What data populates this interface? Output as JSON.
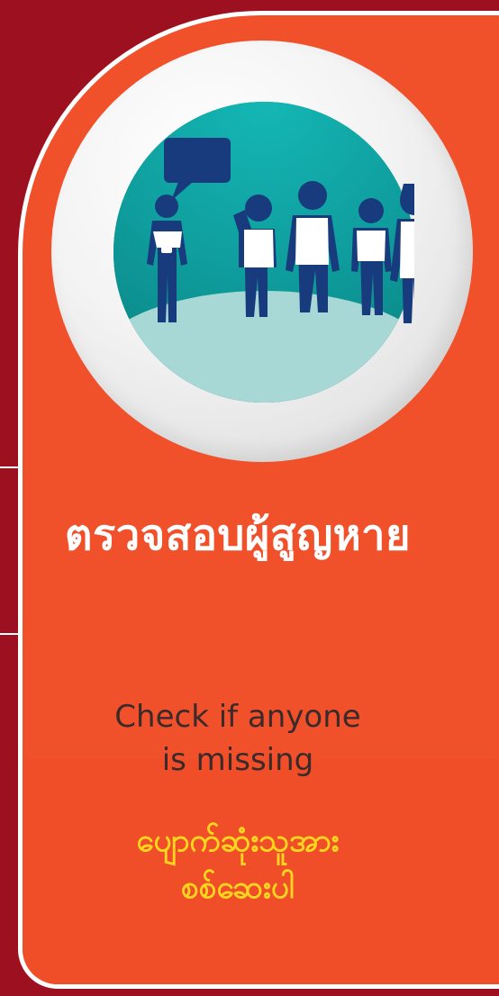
{
  "colors": {
    "background": "#9d1020",
    "card": "#f0512b",
    "title_text": "#ffffff",
    "subtitle_text": "#3b2a2a",
    "translation_text": "#ffd51f",
    "circle_bg": "#0f9c9c",
    "figures": "#173b7c"
  },
  "content": {
    "thai_title": "ตรวจสอบผู้สูญหาย",
    "english_line_1": "Check if anyone",
    "english_line_2": "is missing",
    "burmese_line_1": "ပျောက်ဆုံးသူအား",
    "burmese_line_2": "စစ်ဆေးပါ"
  },
  "icons": {
    "main_illustration": "group-of-people-with-speech-bubble-icon"
  }
}
